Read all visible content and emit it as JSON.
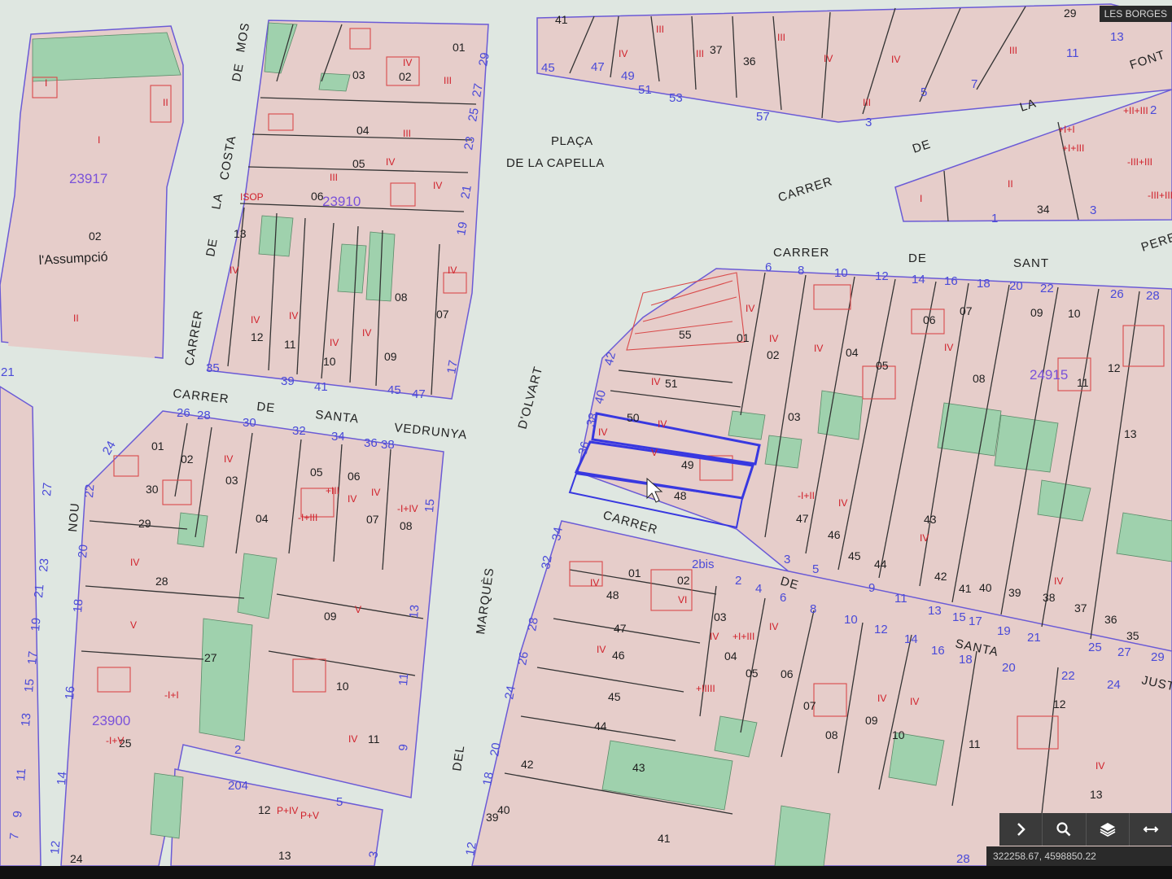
{
  "municipality": "LES BORGES",
  "coordinates": "322258.67, 4598850.22",
  "toolbar": {
    "items": [
      {
        "icon": "chevron-right-icon"
      },
      {
        "icon": "search-icon"
      },
      {
        "icon": "layers-icon"
      },
      {
        "icon": "arrows-horizontal-icon"
      }
    ]
  },
  "colors": {
    "street": "#dfe7e1",
    "parcel": "#e7c9c6",
    "green_area": "#9fd1ad",
    "block_outline": "#6b5bd6",
    "floor_text": "#d0202a",
    "selection": "#3838e0"
  },
  "map": {
    "streets": {
      "placa_line1": "PLAÇA",
      "placa_line2": "DE LA CAPELLA",
      "carrer_de_santa_vedrunya": [
        "CARRER",
        "DE",
        "SANTA",
        "VEDRUNYA"
      ],
      "carrer_de_sant": [
        "CARRER",
        "DE",
        "SANT"
      ],
      "carrer_de_la_font": [
        "CARRER",
        "DE",
        "LA",
        "FONT"
      ],
      "dolvart": "D'OLVART",
      "carrer_de_santa_justa": [
        "CARRER",
        "DE",
        "SANTA",
        "JUST"
      ],
      "del_marques": [
        "DEL",
        "MARQUÈS"
      ],
      "nou": "NOU",
      "costa": [
        "DE",
        "LA",
        "COSTA",
        "DE",
        "MOS"
      ],
      "carrer_left": "CARRER",
      "pere": "PERE",
      "assumpcio": "l'Assumpció"
    },
    "blocks": [
      "23917",
      "23910",
      "24915",
      "23900"
    ],
    "selected_parcels": [
      "49"
    ]
  }
}
